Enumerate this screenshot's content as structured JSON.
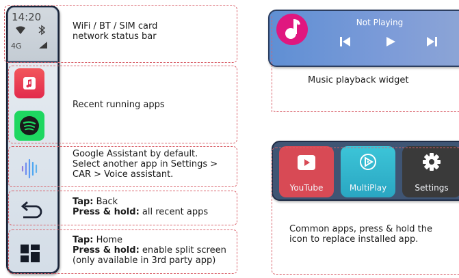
{
  "sidebar": {
    "time": "14:20",
    "network_label": "4G"
  },
  "callouts": {
    "status_bar": [
      "WiFi / BT / SIM card",
      "network status bar"
    ],
    "recent_apps": "Recent running apps",
    "assistant": [
      "Google Assistant by default.",
      "Select another app in Settings >",
      "CAR > Voice assistant."
    ],
    "back": {
      "tap_label": "Tap:",
      "tap_text": "Back",
      "hold_label": "Press & hold:",
      "hold_text": "all recent apps"
    },
    "home": {
      "tap_label": "Tap:",
      "tap_text": "Home",
      "hold_label": "Press & hold:",
      "hold_text": "enable split screen",
      "note": "(only available in 3rd party app)"
    },
    "music_widget": "Music playback widget",
    "common_apps": [
      "Common apps, press & hold the",
      "icon to replace  installed app."
    ]
  },
  "music": {
    "status": "Not Playing"
  },
  "apps": [
    {
      "label": "YouTube",
      "color": "#d84a55"
    },
    {
      "label": "MultiPlay",
      "color": "#36b3c9"
    },
    {
      "label": "Settings",
      "color": "#3a3a3a"
    }
  ],
  "colors": {
    "dash": "#d9626b",
    "sidebar": "#45577a",
    "music_icon": "#e0177f",
    "spotify": "#1ed760"
  }
}
